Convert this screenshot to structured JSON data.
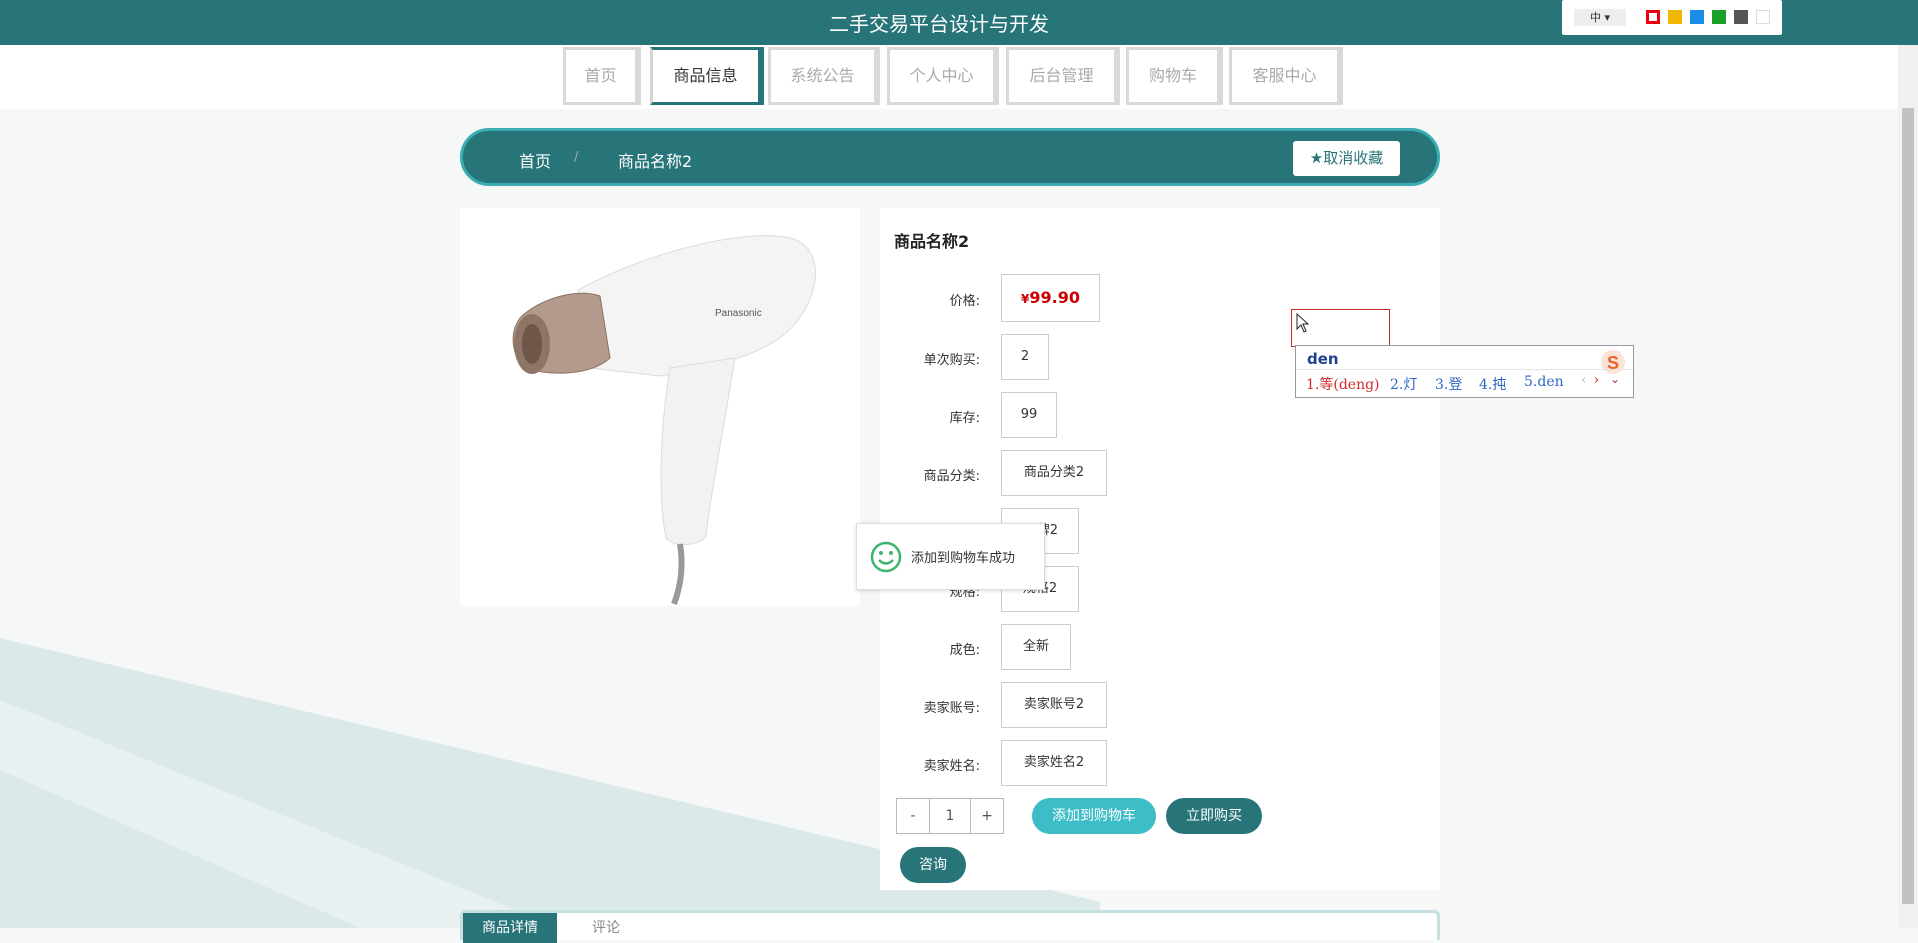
{
  "header": {
    "title": "二手交易平台设计与开发",
    "lang_label": "中",
    "theme_colors": [
      "#e60012",
      "#f0b600",
      "#1a8ee6",
      "#19a029",
      "#555555",
      "#ffffff"
    ]
  },
  "nav": {
    "items": [
      {
        "label": "首页",
        "active": false
      },
      {
        "label": "商品信息",
        "active": true
      },
      {
        "label": "系统公告",
        "active": false
      },
      {
        "label": "个人中心",
        "active": false
      },
      {
        "label": "后台管理",
        "active": false
      },
      {
        "label": "购物车",
        "active": false
      },
      {
        "label": "客服中心",
        "active": false
      }
    ]
  },
  "breadcrumb": {
    "home": "首页",
    "separator": "/",
    "current": "商品名称2",
    "fav_label": "取消收藏"
  },
  "product": {
    "name": "商品名称2",
    "price_currency": "¥",
    "price": "99.90",
    "fields": [
      {
        "label": "价格:",
        "value": ""
      },
      {
        "label": "单次购买:",
        "value": "2"
      },
      {
        "label": "库存:",
        "value": "99"
      },
      {
        "label": "商品分类:",
        "value": "商品分类2"
      },
      {
        "label": "",
        "value": "牌2"
      },
      {
        "label": "规格:",
        "value": "规格2"
      },
      {
        "label": "成色:",
        "value": "全新"
      },
      {
        "label": "卖家账号:",
        "value": "卖家账号2"
      },
      {
        "label": "卖家姓名:",
        "value": "卖家姓名2"
      }
    ],
    "quantity": {
      "minus": "-",
      "value": "1",
      "plus": "+"
    },
    "add_cart_label": "添加到购物车",
    "buy_now_label": "立即购买",
    "consult_label": "咨询",
    "image_brand": "Panasonic"
  },
  "toast": {
    "text": "添加到购物车成功"
  },
  "ime": {
    "composition": "den",
    "candidates": [
      "1.等(deng)",
      "2.灯",
      "3.登",
      "4.扽",
      "5.den"
    ]
  },
  "tabs": [
    "商品详情",
    "评论"
  ],
  "colors": {
    "primary": "#277479",
    "accent": "#3cbdc8",
    "price": "#cc0000"
  }
}
